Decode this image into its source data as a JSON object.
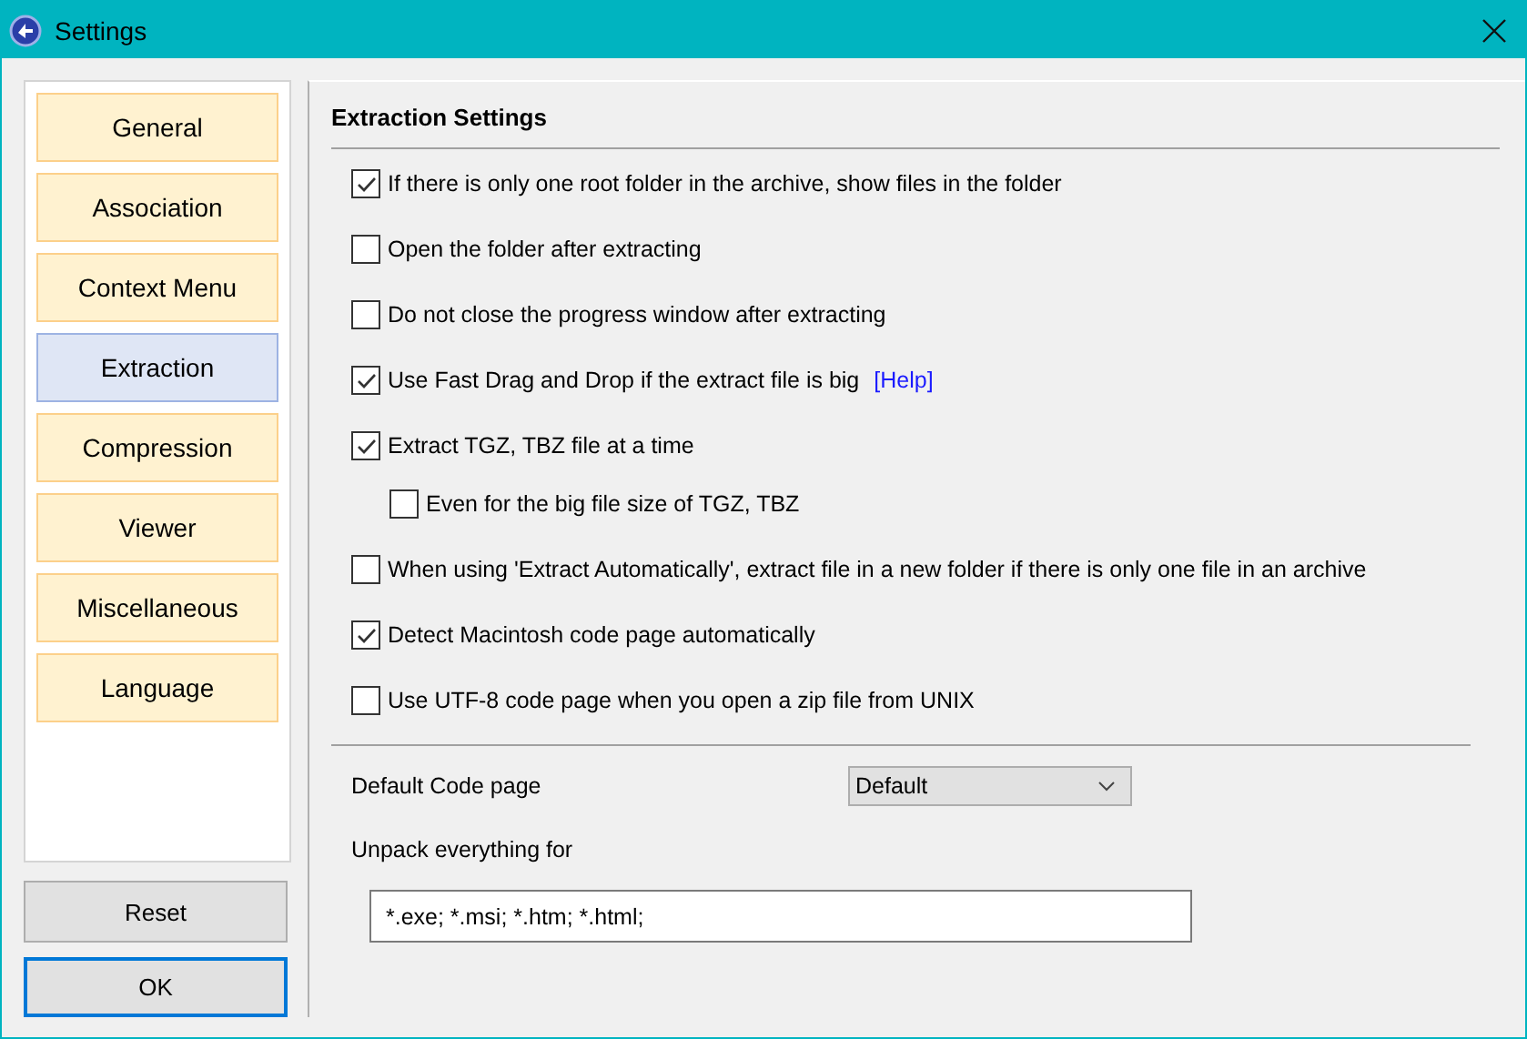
{
  "window": {
    "title": "Settings"
  },
  "sidebar": {
    "items": [
      {
        "label": "General",
        "selected": false
      },
      {
        "label": "Association",
        "selected": false
      },
      {
        "label": "Context Menu",
        "selected": false
      },
      {
        "label": "Extraction",
        "selected": true
      },
      {
        "label": "Compression",
        "selected": false
      },
      {
        "label": "Viewer",
        "selected": false
      },
      {
        "label": "Miscellaneous",
        "selected": false
      },
      {
        "label": "Language",
        "selected": false
      }
    ]
  },
  "buttons": [
    "Reset",
    "OK"
  ],
  "section_title": "Extraction Settings",
  "options": [
    {
      "label": "If there is only one root folder in the archive, show files in the folder",
      "checked": true
    },
    {
      "label": "Open the folder after extracting",
      "checked": false
    },
    {
      "label": "Do not close the progress window after extracting",
      "checked": false
    },
    {
      "label": "Use Fast Drag and Drop if the extract file is big",
      "checked": true,
      "link": "[Help]"
    },
    {
      "label": "Extract TGZ, TBZ file at a time",
      "checked": true,
      "children": [
        {
          "label": "Even for the big file size of TGZ, TBZ",
          "checked": false
        }
      ]
    },
    {
      "label": "When using 'Extract Automatically', extract file in a new folder if there is only one file in an archive",
      "checked": false
    },
    {
      "label": "Detect Macintosh code page automatically",
      "checked": true
    },
    {
      "label": "Use UTF-8 code page when you open a zip file from UNIX",
      "checked": false
    }
  ],
  "code_page": {
    "label": "Default Code page",
    "value": "Default"
  },
  "unpack": {
    "label": "Unpack everything for",
    "value": "*.exe; *.msi; *.htm; *.html;"
  }
}
